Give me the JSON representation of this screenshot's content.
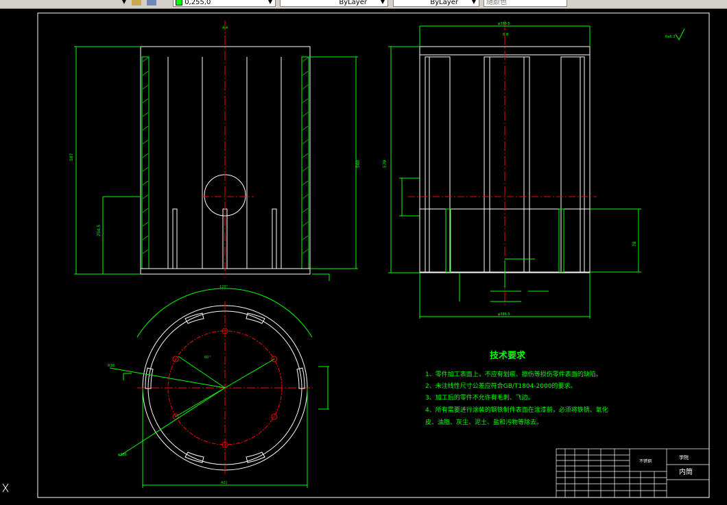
{
  "toolbar": {
    "color_value": "0,255,0",
    "linetype_value": "ByLayer",
    "lineweight_value": "ByLayer",
    "plotstyle_value": "随颜色"
  },
  "technical_requirements": {
    "title": "技术要求",
    "items": [
      "1、零件加工表面上，不应有划痕、擦伤等损伤零件表面的缺陷。",
      "2、未注线性尺寸公差应符合GB/T1804-2000的要求。",
      "3、加工后的零件不允许有毛刺、飞边。",
      "4、所有需要进行涂装的钢铁制件表面在涂漆前，必须将铁锈、氧化",
      "皮、油脂、灰尘、泥土、盐和污物等除去。"
    ]
  },
  "title_block": {
    "part_name": "内筒",
    "material": "不锈钢",
    "company": "学院"
  },
  "dimensions": {
    "top_width": "φ386.5",
    "bottom_width": "φ386.5",
    "left_height": "587",
    "right_height": "560",
    "right_total_height": "579",
    "left_inner": "254.5",
    "right_inner": "78",
    "plan_diameter": "φ386",
    "plan_width": "421",
    "plan_angle": "60°",
    "plan_top": "120°",
    "plan_r": "R38",
    "roughness": "Ra6.3",
    "section_a": "A-A",
    "section_b": "B-B"
  }
}
